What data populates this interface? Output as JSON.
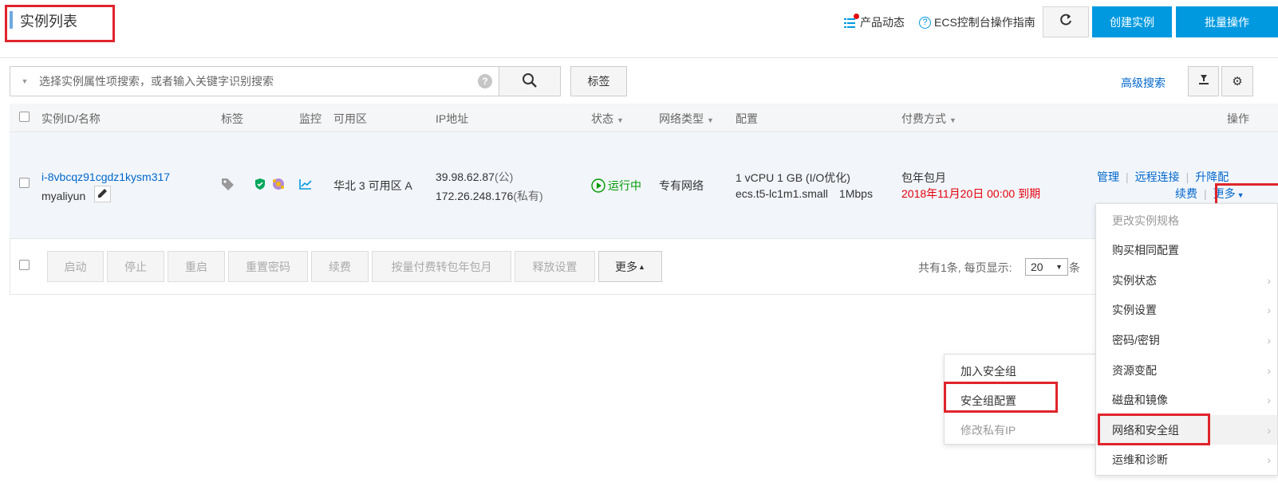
{
  "header": {
    "title": "实例列表",
    "product_news": "产品动态",
    "console_guide": "ECS控制台操作指南",
    "create_instance": "创建实例",
    "batch_ops": "批量操作"
  },
  "search": {
    "placeholder": "选择实例属性项搜索，或者输入关键字识别搜索",
    "tag_button": "标签",
    "advanced": "高级搜索"
  },
  "table": {
    "columns": [
      "实例ID/名称",
      "标签",
      "监控",
      "可用区",
      "IP地址",
      "状态",
      "网络类型",
      "配置",
      "付费方式",
      "操作"
    ],
    "row": {
      "instance_id": "i-8vbcqz91cgdz1kysm317",
      "name": "myaliyun",
      "zone": "华北 3 可用区 A",
      "public_ip": "39.98.62.87",
      "public_tag": "(公)",
      "private_ip": "172.26.248.176",
      "private_tag": "(私有)",
      "status": "运行中",
      "network": "专有网络",
      "config_line1": "1 vCPU 1 GB (I/O优化)",
      "config_line2": "ecs.t5-lc1m1.small",
      "bandwidth": "1Mbps",
      "billing": "包年包月",
      "expire": "2018年11月20日 00:00 到期",
      "actions": {
        "manage": "管理",
        "remote": "远程连接",
        "upgrade": "升降配",
        "renew": "续费",
        "more": "更多"
      }
    }
  },
  "bottom": {
    "buttons": [
      "启动",
      "停止",
      "重启",
      "重置密码",
      "续费",
      "按量付费转包年包月",
      "释放设置",
      "更多"
    ],
    "total_text": "共有1条, 每页显示:",
    "page_size": "20",
    "unit": "条"
  },
  "more_menu": {
    "items": [
      {
        "label": "更改实例规格",
        "disabled": true,
        "submenu": false
      },
      {
        "label": "购买相同配置",
        "disabled": false,
        "submenu": false
      },
      {
        "label": "实例状态",
        "disabled": false,
        "submenu": true
      },
      {
        "label": "实例设置",
        "disabled": false,
        "submenu": true
      },
      {
        "label": "密码/密钥",
        "disabled": false,
        "submenu": true
      },
      {
        "label": "资源变配",
        "disabled": false,
        "submenu": true
      },
      {
        "label": "磁盘和镜像",
        "disabled": false,
        "submenu": true
      },
      {
        "label": "网络和安全组",
        "disabled": false,
        "submenu": true
      },
      {
        "label": "运维和诊断",
        "disabled": false,
        "submenu": true
      }
    ]
  },
  "submenu": {
    "items": [
      {
        "label": "加入安全组",
        "disabled": false
      },
      {
        "label": "安全组配置",
        "disabled": false
      },
      {
        "label": "修改私有IP",
        "disabled": true
      }
    ]
  },
  "colors": {
    "primary": "#0099e0",
    "link": "#0066cc",
    "highlight": "#e0242c",
    "running": "#009900",
    "expire": "#e3000b"
  }
}
